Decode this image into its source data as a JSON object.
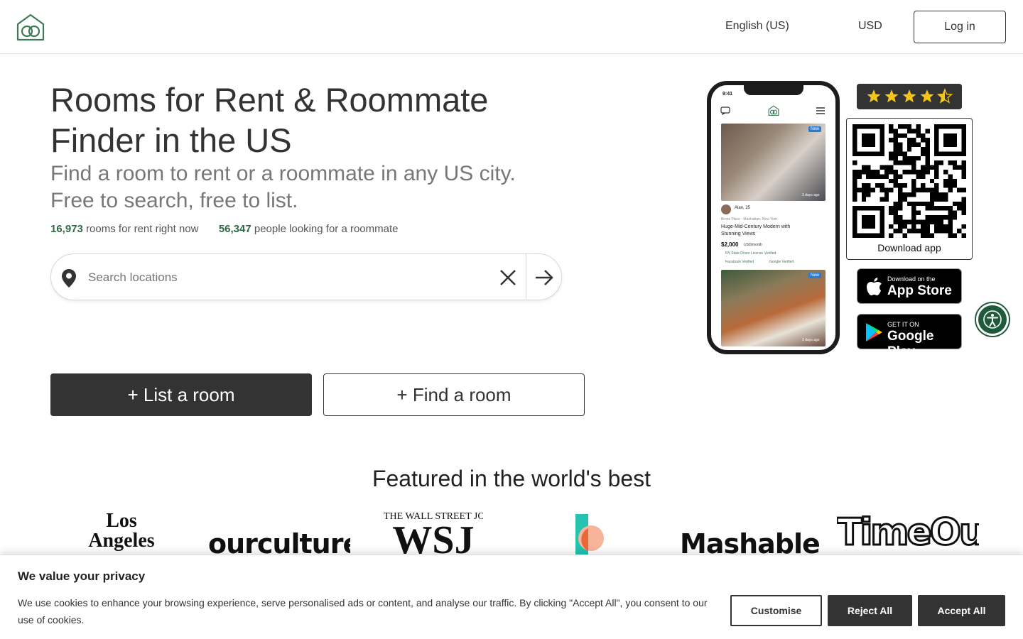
{
  "header": {
    "language": "English (US)",
    "currency": "USD",
    "login_label": "Log in"
  },
  "hero": {
    "title_line1": "Rooms for Rent & Roommate",
    "title_line2": "Finder in the US",
    "subtitle_line1": "Find a room to rent or a roommate in any US city.",
    "subtitle_line2": "Free to search, free to list.",
    "stats": {
      "rooms_count": "16,973",
      "rooms_text": "rooms for rent right now",
      "people_count": "56,347",
      "people_text": "people looking for a roommate"
    },
    "search": {
      "placeholder": "Search locations",
      "value": ""
    },
    "list_room_label": "+ List a room",
    "find_room_label": "+ Find a room"
  },
  "phone_mock": {
    "time": "9:41",
    "badge": "New",
    "card1": {
      "user": "Alan, 25",
      "location": "Bronx Place · Manhattan, New York",
      "title_line1": "Huge-Mid-Century Modern with",
      "title_line2": "Stunning Views",
      "price": "$2,000",
      "price_unit": "USD/month",
      "verified1": "NY State Driver License Verified",
      "verified2": "Facebook Verified",
      "verified3": "Google Verified",
      "posted": "3 days ago"
    },
    "card2": {
      "posted": "3 days ago"
    }
  },
  "app": {
    "rating_stars": 4.5,
    "download_label": "Download app",
    "appstore_small": "Download on the",
    "appstore_big": "App Store",
    "gplay_small": "GET IT ON",
    "gplay_big": "Google Play"
  },
  "featured": {
    "title": "Featured in the world's best",
    "logos": {
      "la_line1": "Los",
      "la_line2": "Angeles",
      "ourculture": "ourculture",
      "wsj_top": "THE WALL STREET JOURNAL.",
      "wsj_big": "WSJ",
      "mashable": "Mashable",
      "timeout": "TimeOut"
    }
  },
  "cookie": {
    "title": "We value your privacy",
    "text": "We use cookies to enhance your browsing experience, serve personalised ads or content, and analyse our traffic. By clicking \"Accept All\", you consent to our use of cookies.",
    "customise_label": "Customise",
    "reject_label": "Reject All",
    "accept_label": "Accept All"
  },
  "colors": {
    "brand_green": "#2f6a45",
    "dark": "#333333",
    "accessibility": "#1f5a3b"
  }
}
